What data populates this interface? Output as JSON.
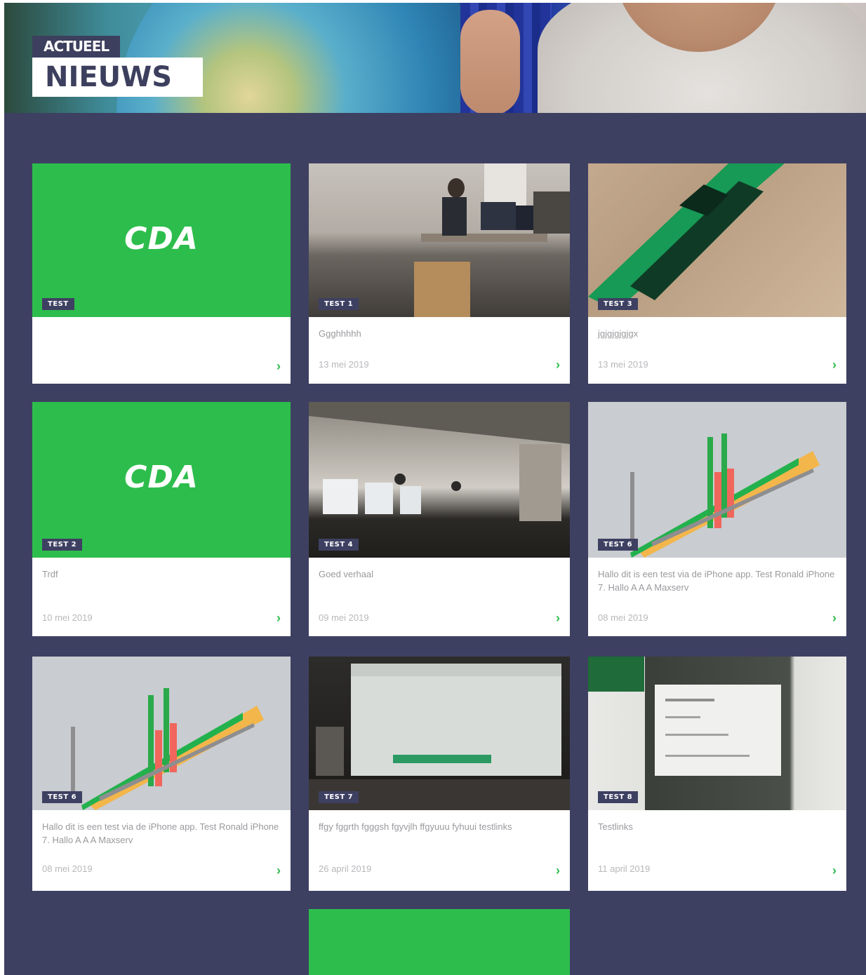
{
  "header": {
    "kicker": "ACTUEEL",
    "title": "NIEUWS"
  },
  "brand": {
    "logo_text": "CDA",
    "green": "#2dbd4c",
    "navy": "#3e4062"
  },
  "cards": [
    {
      "tag": "TEST",
      "title": "",
      "date": "",
      "arrow": "›",
      "image": "cda-logo"
    },
    {
      "tag": "TEST 1",
      "title": "Ggghhhhh",
      "date": "13 mei 2019",
      "arrow": "›",
      "image": "office-photo"
    },
    {
      "tag": "TEST 3",
      "title": "jgjgjgjgjgx",
      "date": "13 mei 2019",
      "arrow": "›",
      "image": "green-device-photo"
    },
    {
      "tag": "TEST 2",
      "title": "Trdf",
      "date": "10 mei 2019",
      "arrow": "›",
      "image": "cda-logo"
    },
    {
      "tag": "TEST 4",
      "title": "Goed verhaal",
      "date": "09 mei 2019",
      "arrow": "›",
      "image": "hall-photo"
    },
    {
      "tag": "TEST 6",
      "title": "Hallo dit is een test via de iPhone app. Test Ronald iPhone 7. Hallo A A A Maxserv",
      "date": "08 mei 2019",
      "arrow": "›",
      "image": "3d-chart-photo"
    },
    {
      "tag": "TEST 6",
      "title": "Hallo dit is een test via de iPhone app. Test Ronald iPhone 7. Hallo A A A Maxserv",
      "date": "08 mei 2019",
      "arrow": "›",
      "image": "3d-chart-photo"
    },
    {
      "tag": "TEST 7",
      "title": "ffgy fggrth fgggsh fgyvjlh ffgyuuu fyhuui testlinks",
      "date": "26 april 2019",
      "arrow": "›",
      "image": "screen-photo"
    },
    {
      "tag": "TEST 8",
      "title": "Testlinks",
      "date": "11 april 2019",
      "arrow": "›",
      "image": "sign-photo"
    },
    {
      "tag": "",
      "title": "",
      "date": "",
      "arrow": "",
      "image": "cda-logo"
    }
  ]
}
